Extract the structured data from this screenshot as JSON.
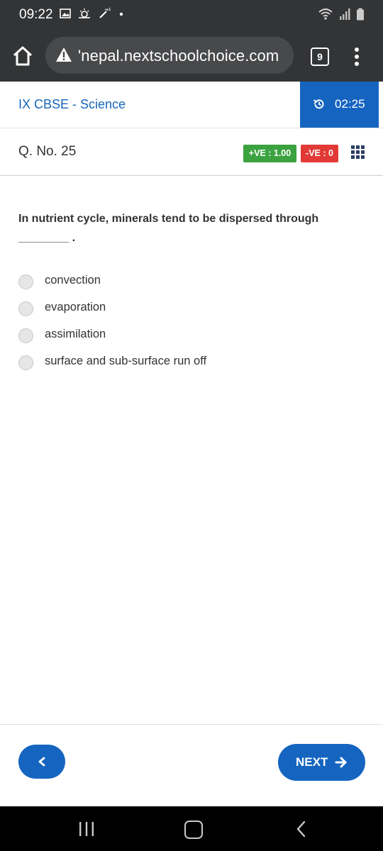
{
  "status_bar": {
    "time": "09:22",
    "left_icons": [
      "image-icon",
      "weather-icon",
      "wand-icon",
      "dot-icon"
    ],
    "right_icons": [
      "wifi-icon",
      "signal-icon",
      "battery-icon"
    ]
  },
  "browser": {
    "url": "'nepal.nextschoolchoice.com",
    "tab_count": "9",
    "icons": [
      "home-icon",
      "warning-icon",
      "kebab-menu-icon"
    ]
  },
  "header": {
    "course_title": "IX CBSE - Science",
    "timer": "02:25"
  },
  "question_bar": {
    "number_label": "Q. No. 25",
    "positive_marks": "+VE : 1.00",
    "negative_marks": "-VE : 0"
  },
  "question": {
    "text": "In nutrient cycle, minerals tend to be dispersed through ________ .",
    "options": [
      {
        "label": "convection"
      },
      {
        "label": "evaporation"
      },
      {
        "label": "assimilation"
      },
      {
        "label": "surface and sub-surface run off"
      }
    ]
  },
  "footer": {
    "next_label": "NEXT"
  },
  "colors": {
    "primary": "#1565c0",
    "positive": "#3ba23f",
    "negative": "#e13a36",
    "chrome": "#333436"
  }
}
